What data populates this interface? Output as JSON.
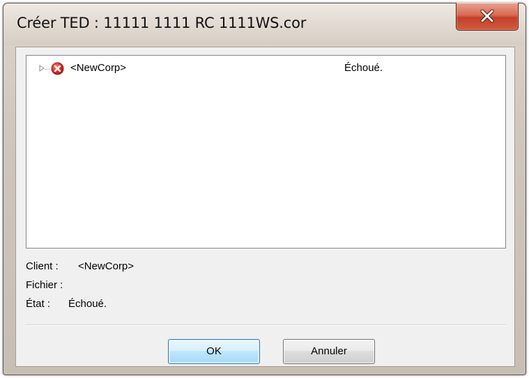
{
  "window": {
    "title": "Créer TED : 11111 1111 RC 1111WS.cor",
    "close_icon": "close-x-icon"
  },
  "tree": {
    "rows": [
      {
        "name": "<NewCorp>",
        "status": "Échoué.",
        "icon": "error-icon",
        "expander_icon": "expand-triangle-icon"
      }
    ]
  },
  "details": {
    "client_label": "Client :",
    "client_value": "<NewCorp>",
    "file_label": "Fichier :",
    "file_value": "",
    "state_label": "État :",
    "state_value": "Échoué."
  },
  "buttons": {
    "ok_label": "OK",
    "cancel_label": "Annuler"
  },
  "colors": {
    "close_button": "#c74a32",
    "error_icon": "#d8322a",
    "ok_button_border": "#3c7fb1"
  }
}
